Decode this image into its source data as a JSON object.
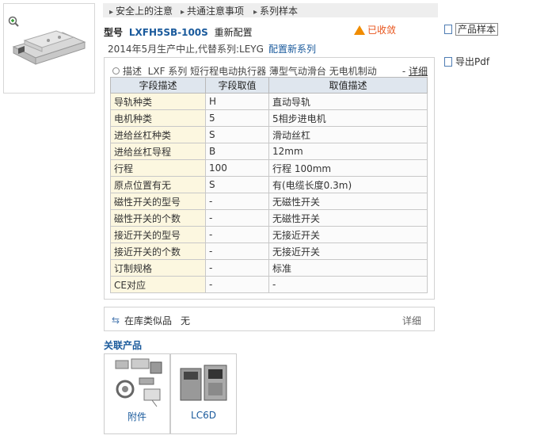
{
  "top_links": [
    "安全上的注意",
    "共通注意事项",
    "系列样本"
  ],
  "model": {
    "label": "型号",
    "code": "LXFH5SB-100S",
    "revise": "重新配置"
  },
  "discontinued": "已收敛",
  "status": {
    "text": "2014年5月生产中止,代替系列:LEYG",
    "link": "配置新系列"
  },
  "side": {
    "catalog": "产品样本",
    "export": "导出Pdf"
  },
  "description": {
    "label": "描述",
    "text": "LXF 系列 短行程电动执行器 薄型气动滑台 无电机制动",
    "more_prefix": "-",
    "more": "详细"
  },
  "spec_table": {
    "headers": [
      "字段描述",
      "字段取值",
      "取值描述"
    ],
    "rows": [
      [
        "导轨种类",
        "H",
        "直动导轨"
      ],
      [
        "电机种类",
        "5",
        "5相步进电机"
      ],
      [
        "进给丝杠种类",
        "S",
        "滑动丝杠"
      ],
      [
        "进给丝杠导程",
        "B",
        "12mm"
      ],
      [
        "行程",
        "100",
        "行程 100mm"
      ],
      [
        "原点位置有无",
        "S",
        "有(电缆长度0.3m)"
      ],
      [
        "磁性开关的型号",
        "-",
        "无磁性开关"
      ],
      [
        "磁性开关的个数",
        "-",
        "无磁性开关"
      ],
      [
        "接近开关的型号",
        "-",
        "无接近开关"
      ],
      [
        "接近开关的个数",
        "-",
        "无接近开关"
      ],
      [
        "订制规格",
        "-",
        "标准"
      ],
      [
        "CE对应",
        "-",
        "-"
      ]
    ]
  },
  "similar": {
    "label": "在库类似品",
    "value": "无",
    "detail": "详细"
  },
  "related": {
    "title": "关联产品",
    "items": [
      "附件",
      "LC6D"
    ]
  },
  "colors": {
    "link": "#1a5a9c",
    "header_bg": "#dfe6ee",
    "first_col_bg": "#fcf7e0",
    "warning": "#e8531a"
  }
}
